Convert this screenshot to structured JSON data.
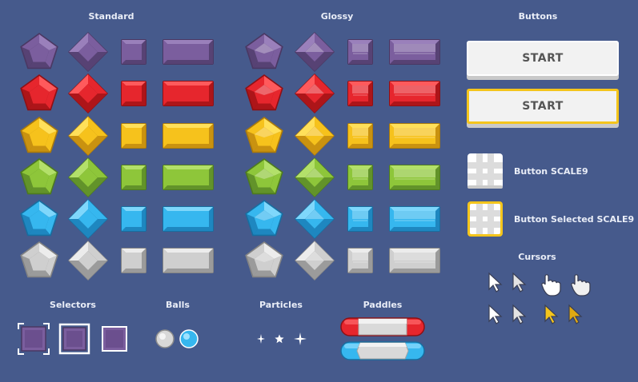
{
  "sections": {
    "standard": "Standard",
    "glossy": "Glossy",
    "buttons": "Buttons",
    "selectors": "Selectors",
    "balls": "Balls",
    "particles": "Particles",
    "paddles": "Paddles",
    "cursors": "Cursors"
  },
  "buttons": {
    "start_label": "START",
    "start_selected_label": "START",
    "scale9_label": "Button SCALE9",
    "scale9_selected_label": "Button Selected SCALE9"
  },
  "gem_colors": [
    {
      "name": "purple",
      "main": "#7b5e9e",
      "light": "#9a80bb",
      "dark": "#574274",
      "edge": "#4a3863"
    },
    {
      "name": "red",
      "main": "#e6262d",
      "light": "#ff5a5c",
      "dark": "#ad1519",
      "edge": "#8e1015"
    },
    {
      "name": "yellow",
      "main": "#f6c21c",
      "light": "#ffe05a",
      "dark": "#c99210",
      "edge": "#a9790c"
    },
    {
      "name": "green",
      "main": "#8ec63a",
      "light": "#b3e06a",
      "dark": "#62932a",
      "edge": "#4d7a1f"
    },
    {
      "name": "blue",
      "main": "#36b7ef",
      "light": "#7fd7fb",
      "dark": "#1e87c0",
      "edge": "#176ea0"
    },
    {
      "name": "gray",
      "main": "#cfcfcf",
      "light": "#ececec",
      "dark": "#9b9b9b",
      "edge": "#838383"
    }
  ],
  "accent_colors": {
    "background": "#465a8c",
    "selected_yellow": "#f4c51c",
    "paddle_red": "#e6262d",
    "paddle_blue": "#36b7ef"
  },
  "gem_shapes": [
    "pentagon-icon",
    "diamond-icon",
    "square-brick-icon",
    "long-brick-icon"
  ]
}
